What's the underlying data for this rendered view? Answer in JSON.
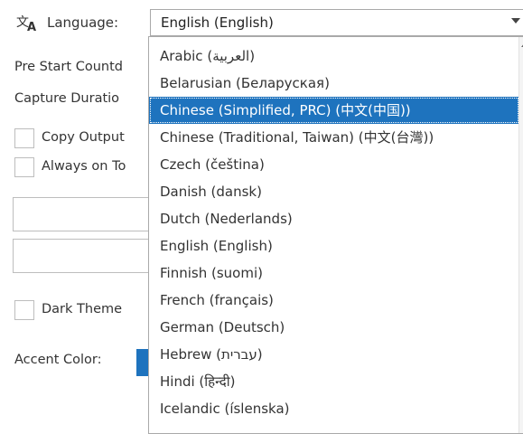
{
  "language": {
    "icon": "translate-icon",
    "label": "Language:",
    "selected_value": "English (English)"
  },
  "settings": {
    "pre_start_countdown_label": "Pre Start Countd",
    "capture_duration_label": "Capture Duratio",
    "copy_output_label": "Copy Output",
    "always_on_top_label": "Always on To",
    "dark_theme_label": "Dark Theme",
    "accent_color_label": "Accent Color:"
  },
  "colors": {
    "accent": "#1e73be"
  },
  "dropdown": {
    "items": [
      "Arabic (العربية)",
      "Belarusian (Беларуская)",
      "Chinese (Simplified, PRC) (中文(中国))",
      "Chinese (Traditional, Taiwan) (中文(台灣))",
      "Czech (čeština)",
      "Danish (dansk)",
      "Dutch (Nederlands)",
      "English (English)",
      "Finnish (suomi)",
      "French (français)",
      "German (Deutsch)",
      "Hebrew (עברית)",
      "Hindi (हिन्दी)",
      "Icelandic (íslenska)"
    ],
    "highlighted": "Chinese (Simplified, PRC) (中文(中国))"
  }
}
